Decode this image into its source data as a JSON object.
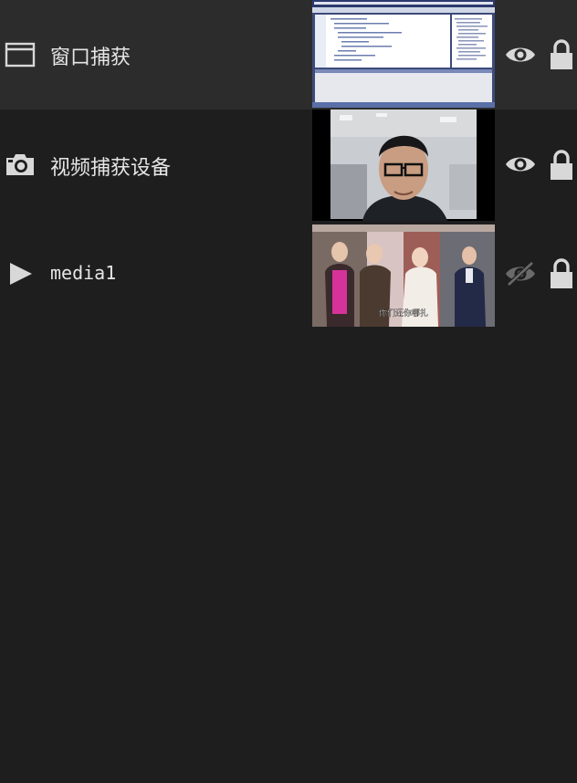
{
  "sources": [
    {
      "name": "窗口捕获",
      "type_icon": "window-icon",
      "visible": true,
      "locked": true,
      "selected": true
    },
    {
      "name": "视频捕获设备",
      "type_icon": "camera-icon",
      "visible": true,
      "locked": true,
      "selected": false
    },
    {
      "name": "media1",
      "type_icon": "play-icon",
      "visible": false,
      "locked": true,
      "selected": false
    }
  ],
  "thumbnails": {
    "media1_subtitle": "你们还你哪扎"
  },
  "colors": {
    "background": "#1e1e1e",
    "selected_row": "#2c2c2c",
    "text": "#e6e6e6",
    "icon": "#d8d8d8",
    "icon_dim": "#6a6a6a"
  }
}
